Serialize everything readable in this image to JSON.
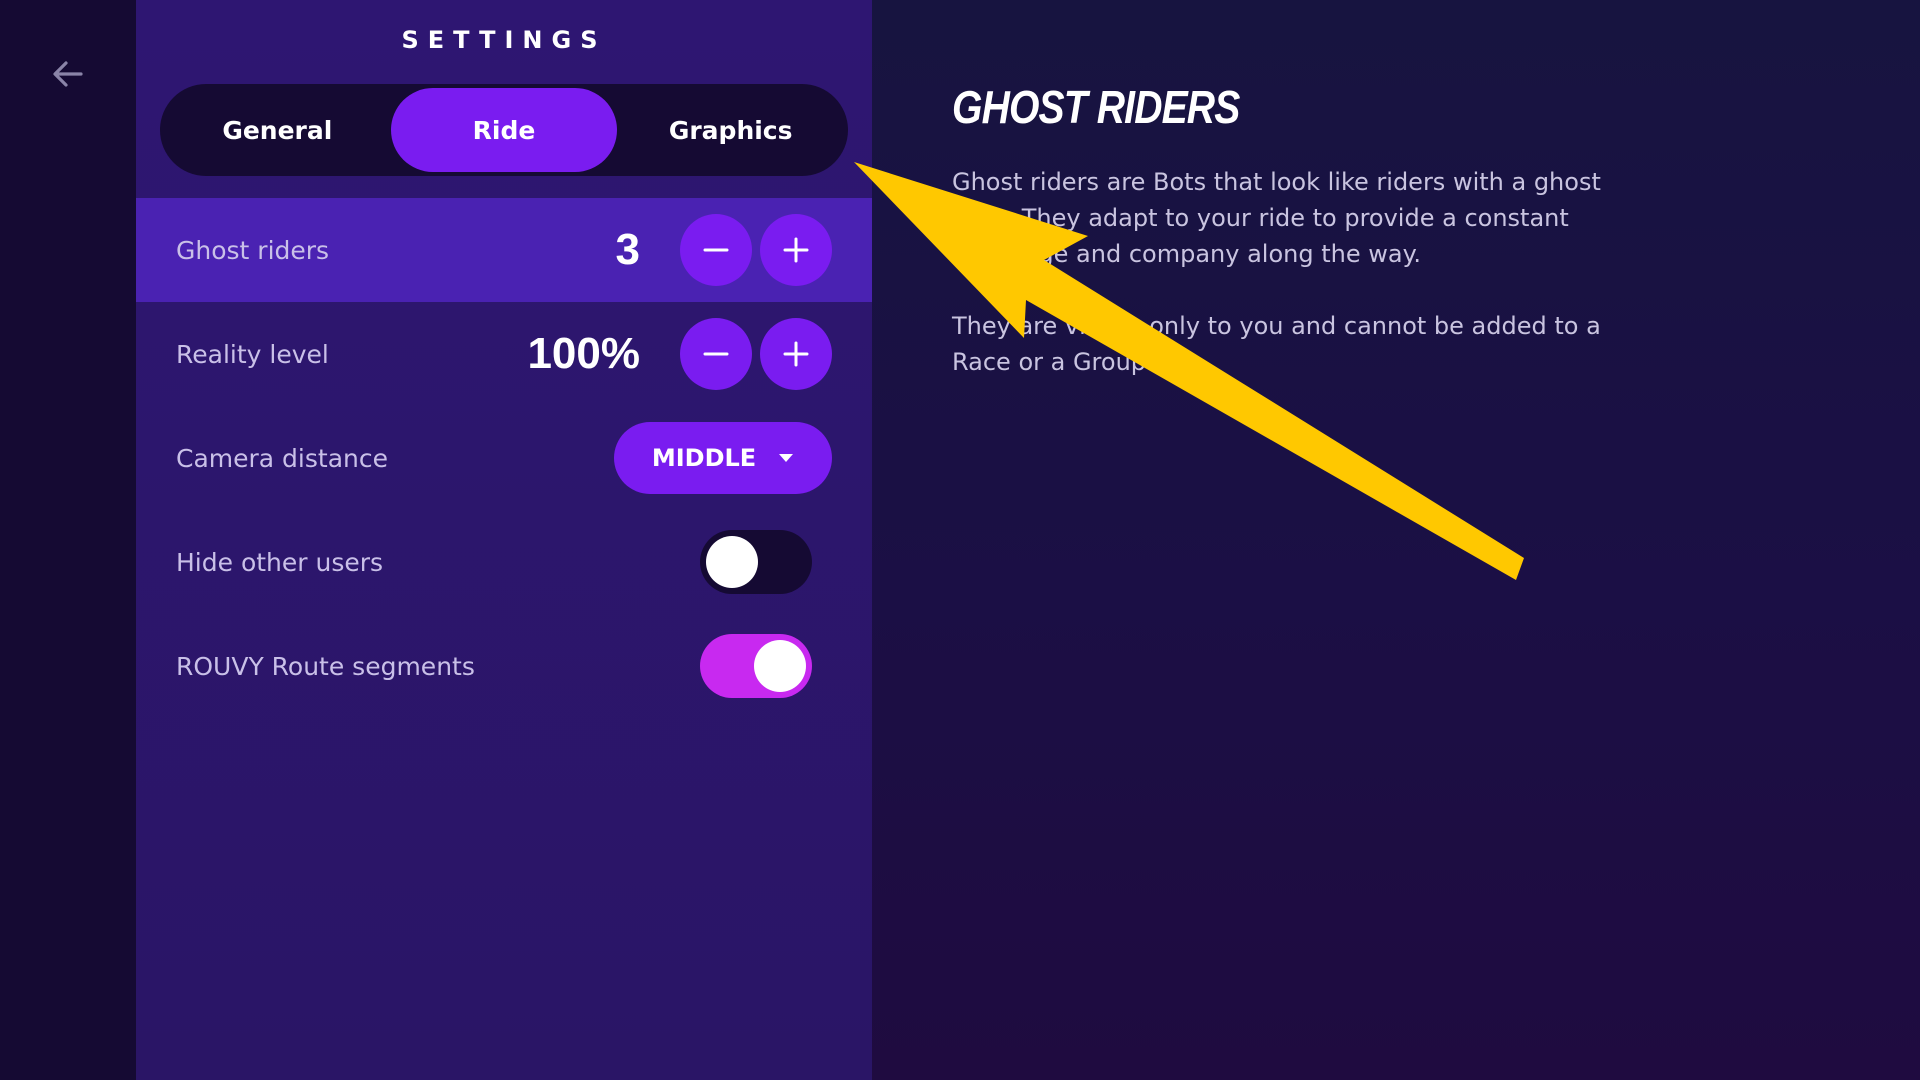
{
  "panel": {
    "title": "SETTINGS"
  },
  "tabs": [
    {
      "label": "General",
      "active": false
    },
    {
      "label": "Ride",
      "active": true
    },
    {
      "label": "Graphics",
      "active": false
    }
  ],
  "settings": {
    "ghost_riders": {
      "label": "Ghost riders",
      "value": "3"
    },
    "reality_level": {
      "label": "Reality level",
      "value": "100%"
    },
    "camera_distance": {
      "label": "Camera distance",
      "value": "MIDDLE"
    },
    "hide_other_users": {
      "label": "Hide other users",
      "enabled": false
    },
    "route_segments": {
      "label": "ROUVY Route segments",
      "enabled": true
    }
  },
  "info": {
    "title": "GHOST RIDERS",
    "paragraph1": "Ghost riders are Bots that look like riders with a ghost aura. They adapt to your ride to provide a constant challenge and company along the way.",
    "paragraph2": "They are visible only to you and cannot be added to a Race or a Group ride."
  },
  "icons": {
    "back": "arrow-left-icon",
    "minus": "minus-icon",
    "plus": "plus-icon",
    "dropdown": "caret-down-icon"
  },
  "colors": {
    "accent": "#7a1cf0",
    "toggle_on": "#c829f0",
    "annotation_arrow": "#ffc800"
  }
}
